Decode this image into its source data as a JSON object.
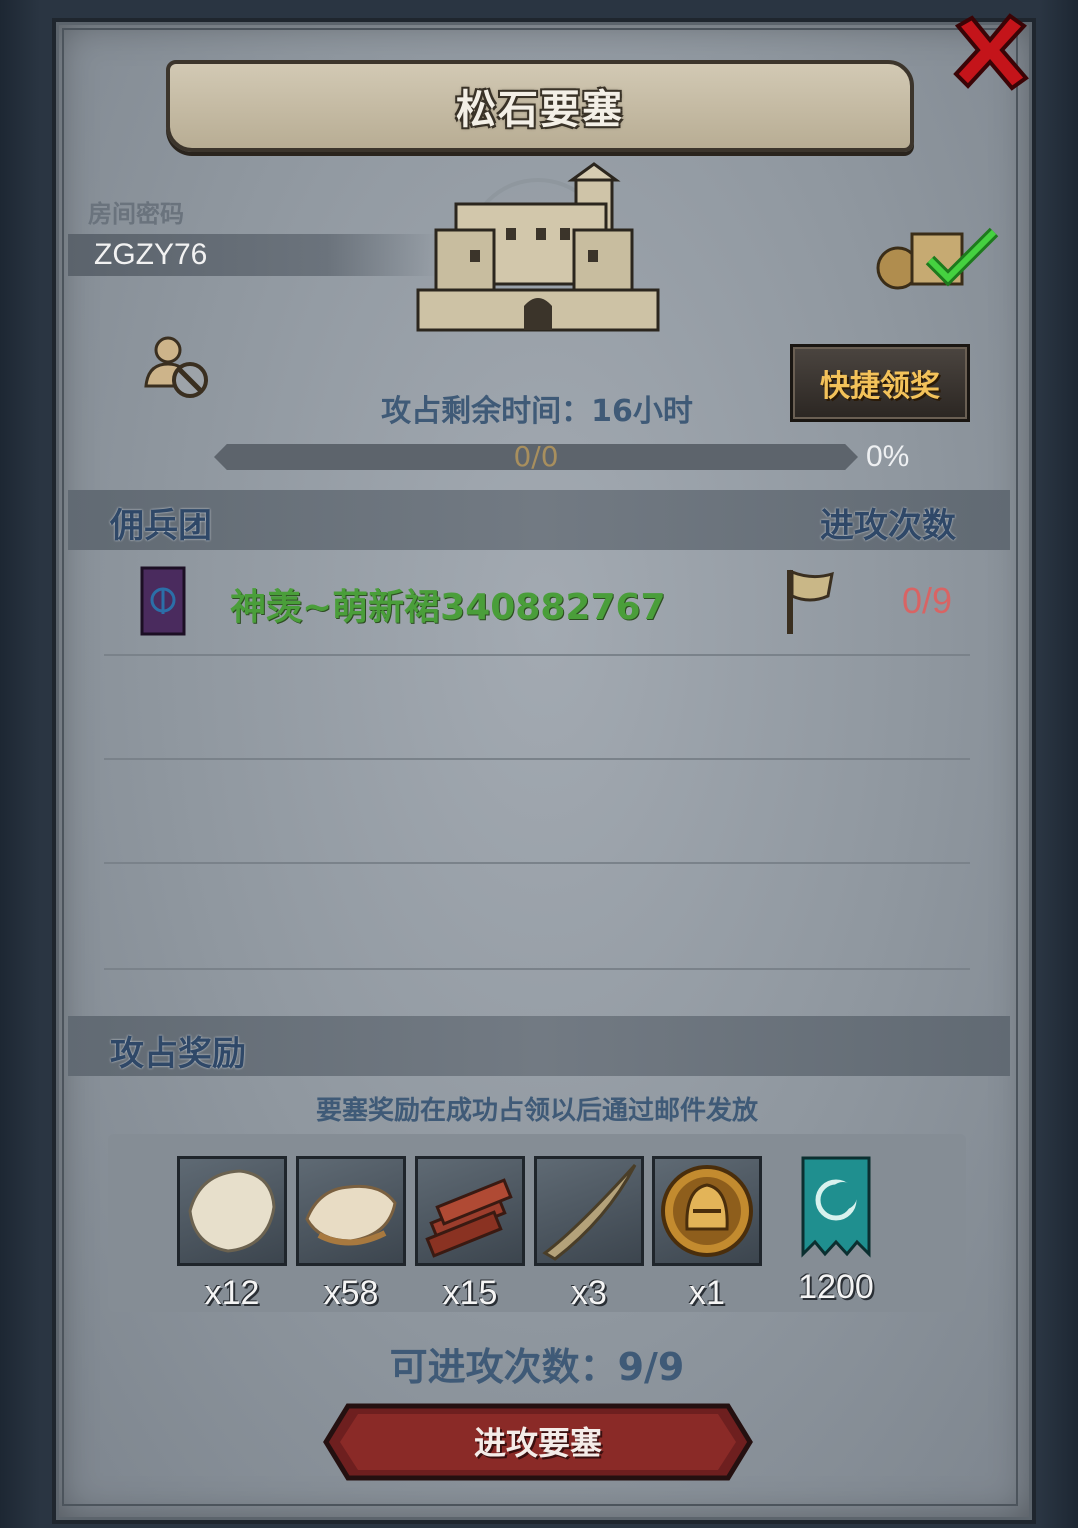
{
  "title": "松石要塞",
  "room": {
    "label": "房间密码",
    "code": "ZGZY76"
  },
  "quick_claim_label": "快捷领奖",
  "time_remaining": "攻占剩余时间：16小时",
  "progress": {
    "text": "0/0",
    "percent_label": "0%",
    "fraction": 0
  },
  "mercenary": {
    "title": "佣兵团",
    "attack_count_title": "进攻次数",
    "members": [
      {
        "name": "神羡~萌新裙340882767",
        "attacks": "0/9"
      }
    ]
  },
  "rewards": {
    "title": "攻占奖励",
    "note": "要塞奖励在成功占领以后通过邮件发放",
    "items": [
      {
        "icon": "fur-pelt-icon",
        "qty": "x12"
      },
      {
        "icon": "hide-leather-icon",
        "qty": "x58"
      },
      {
        "icon": "wood-planks-icon",
        "qty": "x15"
      },
      {
        "icon": "horn-icon",
        "qty": "x3"
      },
      {
        "icon": "knight-helmet-coin-icon",
        "qty": "x1"
      },
      {
        "icon": "banner-token-icon",
        "qty": "1200"
      }
    ]
  },
  "attempts_left": "可进攻次数：9/9",
  "attack_button_label": "进攻要塞",
  "colors": {
    "name_green": "#4a9e3a",
    "count_red": "#d86464",
    "label_blue": "#3f5a77",
    "gold": "#f3c25a"
  }
}
